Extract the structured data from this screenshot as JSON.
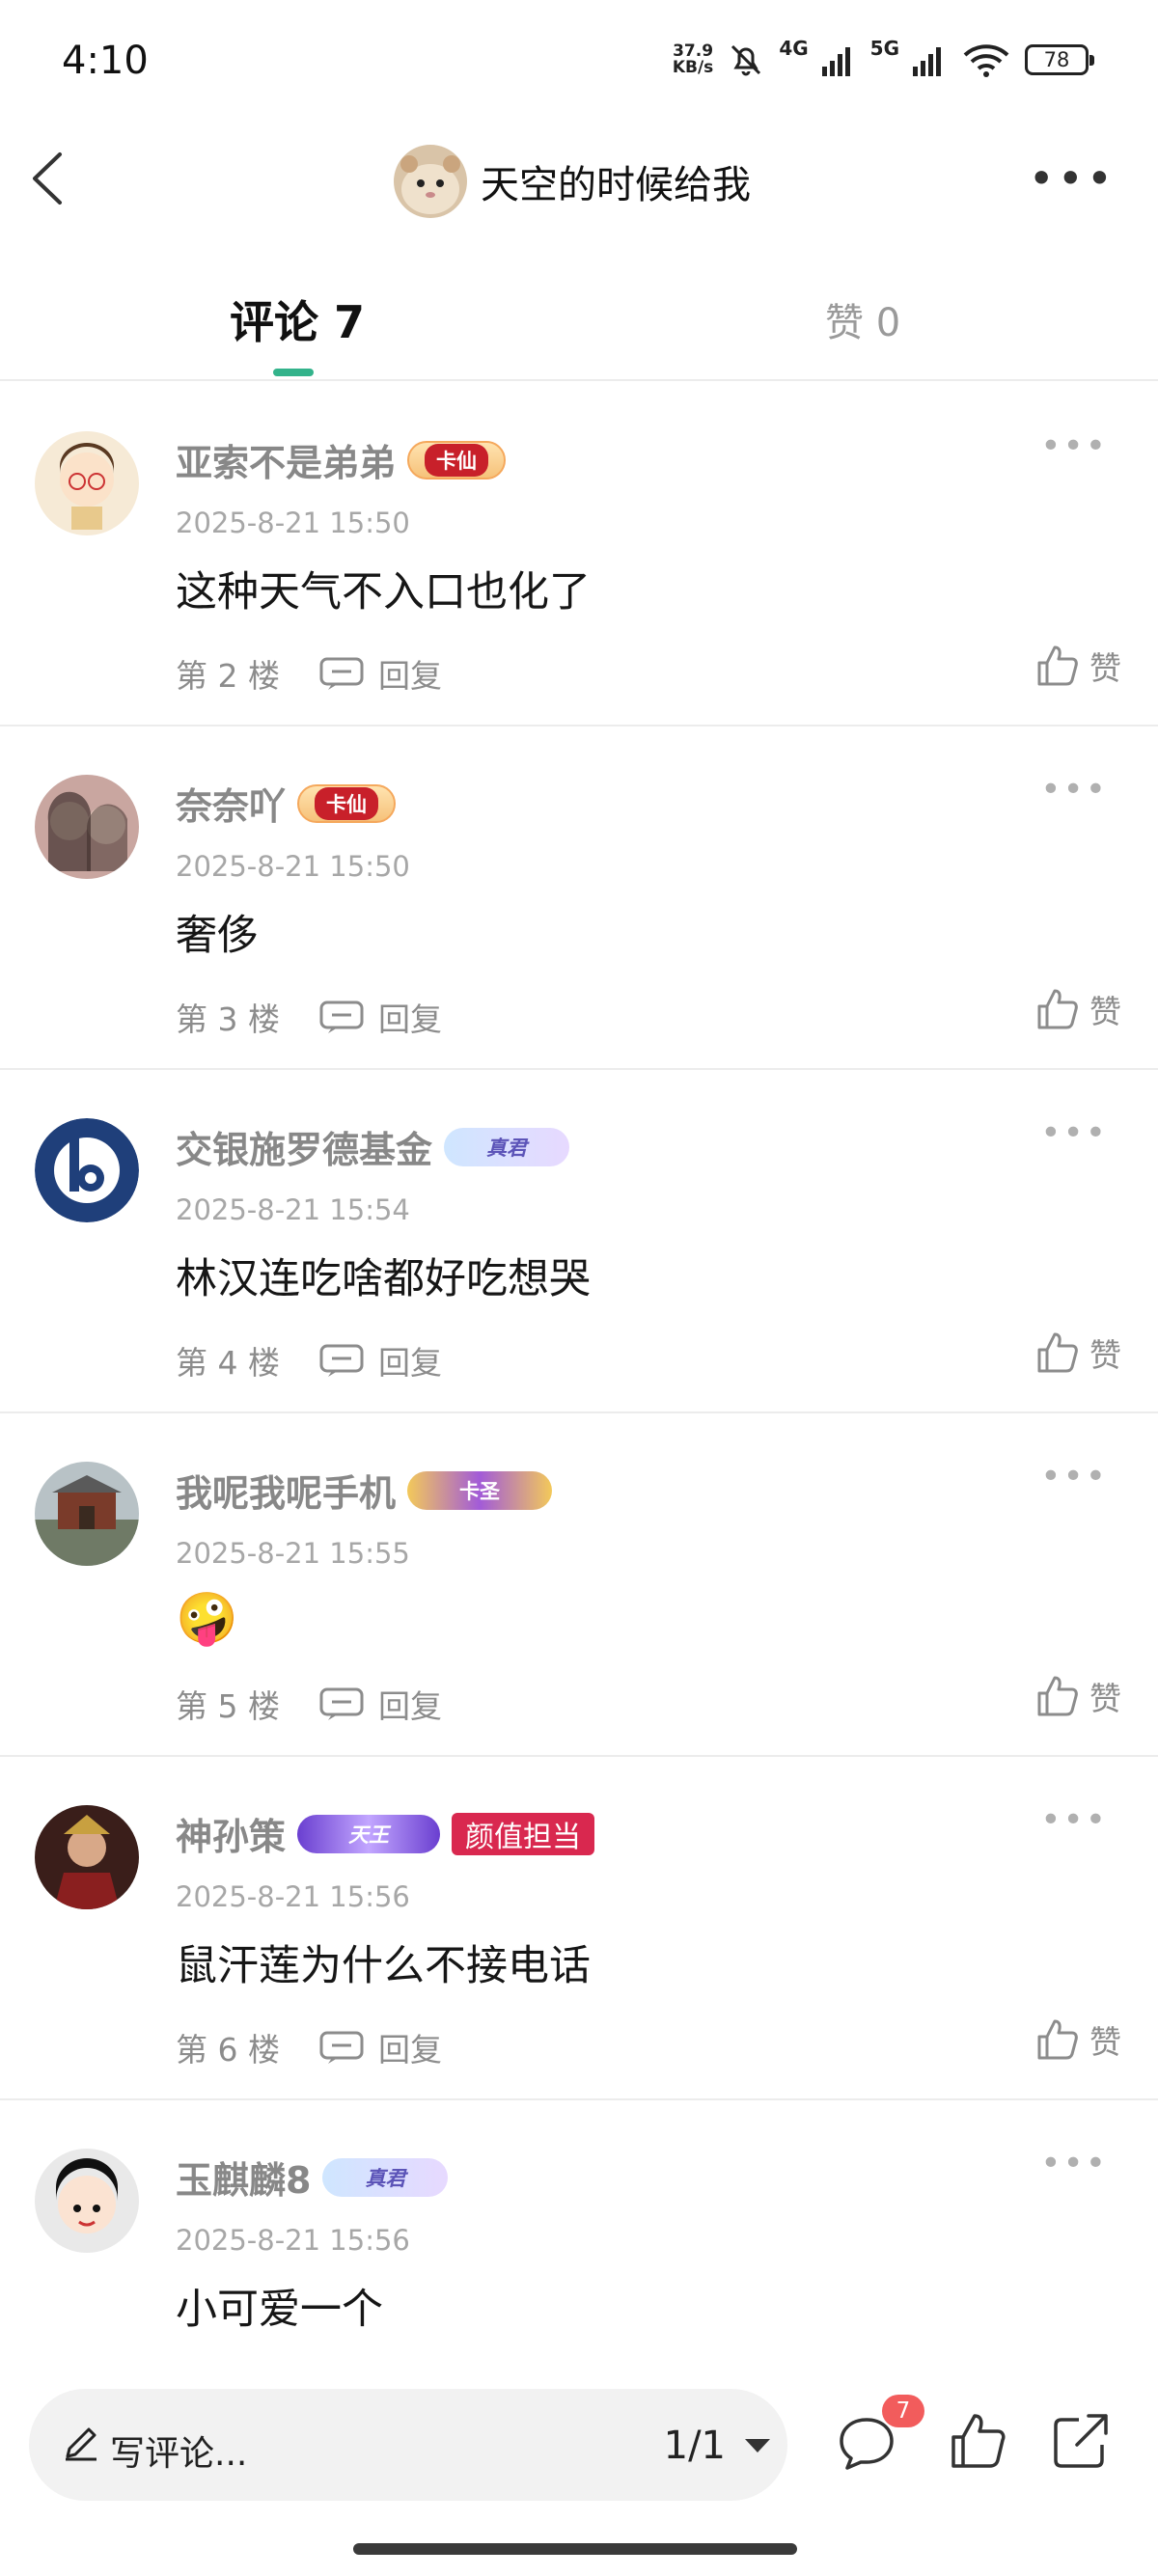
{
  "status_bar": {
    "time": "4:10",
    "net_speed_value": "37.9",
    "net_speed_unit": "KB/s",
    "network_4g": "4G",
    "network_5g": "5G",
    "battery": "78"
  },
  "header": {
    "title": "天空的时候给我"
  },
  "tabs": {
    "comments_label": "评论 7",
    "likes_label": "赞 0"
  },
  "comments": [
    {
      "name": "亚索不是弟弟",
      "badge": "卡仙",
      "time": "2025-8-21 15:50",
      "text": "这种天气不入口也化了",
      "floor": "第 2 楼",
      "reply": "回复",
      "like": "赞"
    },
    {
      "name": "奈奈吖",
      "badge": "卡仙",
      "time": "2025-8-21 15:50",
      "text": "奢侈",
      "floor": "第 3 楼",
      "reply": "回复",
      "like": "赞"
    },
    {
      "name": "交银施罗德基金",
      "badge": "真君",
      "time": "2025-8-21 15:54",
      "text": "林汉连吃啥都好吃想哭",
      "floor": "第 4 楼",
      "reply": "回复",
      "like": "赞"
    },
    {
      "name": "我呢我呢手机",
      "badge": "卡圣",
      "time": "2025-8-21 15:55",
      "text": "🤪",
      "floor": "第 5 楼",
      "reply": "回复",
      "like": "赞"
    },
    {
      "name": "神孙策",
      "badge": "天王",
      "badge2": "颜值担当",
      "time": "2025-8-21 15:56",
      "text": "鼠汗莲为什么不接电话",
      "floor": "第 6 楼",
      "reply": "回复",
      "like": "赞"
    },
    {
      "name": "玉麒麟8",
      "badge": "真君",
      "time": "2025-8-21 15:56",
      "text": "小可爱一个"
    }
  ],
  "bottom_bar": {
    "write_placeholder": "写评论...",
    "page_indicator": "1/1",
    "comment_count": "7"
  },
  "colors": {
    "accent": "#33b38b",
    "badge_red": "#d9284f",
    "count_red": "#f25c5c"
  }
}
